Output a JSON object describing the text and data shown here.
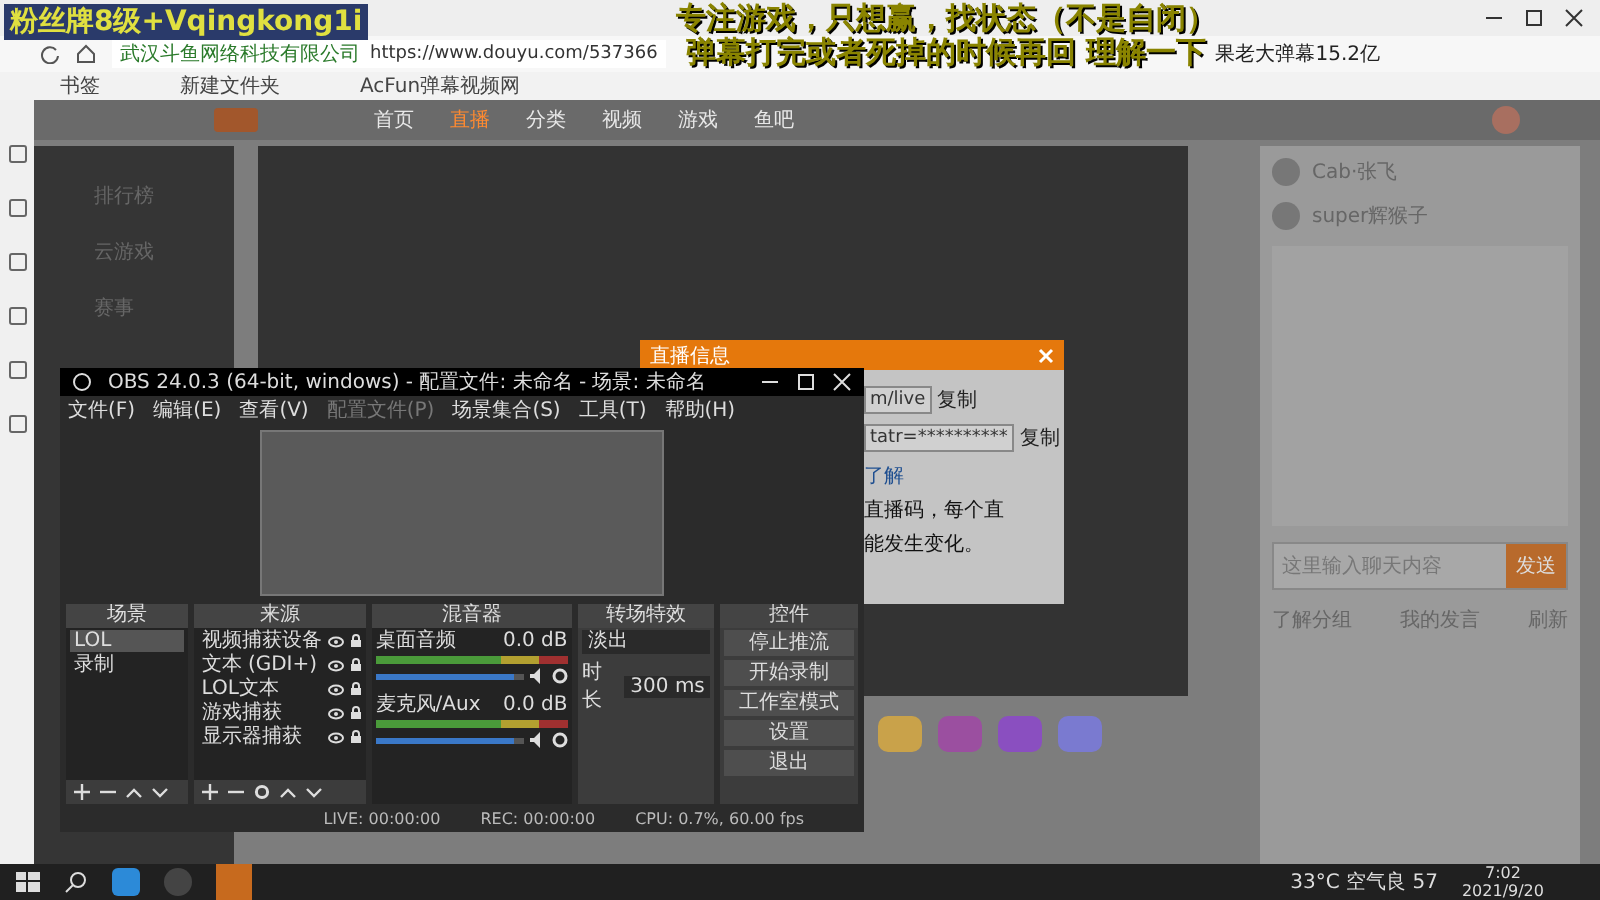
{
  "captions": {
    "badge": "粉丝牌8级+Vqingkong1i",
    "lines": [
      "专注游戏，只想赢，找状态（不是自闭）",
      "弹幕打完或者死掉的时候再回 理解一下"
    ]
  },
  "browser": {
    "site_name": "武汉斗鱼网络科技有限公司",
    "url": "https://www.douyu.com/537366",
    "tab_title": "果老大弹幕15.2亿",
    "bookmarks": [
      "书签",
      "新建文件夹",
      "AcFun弹幕视频网"
    ]
  },
  "site_nav": [
    {
      "label": "首页",
      "selected": false
    },
    {
      "label": "直播",
      "selected": true
    },
    {
      "label": "分类",
      "selected": false
    },
    {
      "label": "视频",
      "selected": false
    },
    {
      "label": "游戏",
      "selected": false
    },
    {
      "label": "鱼吧",
      "selected": false
    }
  ],
  "side_menu": [
    "排行榜",
    "云游戏",
    "赛事"
  ],
  "dialog": {
    "title": "直播信息",
    "fields": [
      {
        "value": "m/live",
        "button": "复制"
      },
      {
        "value": "tatr=**********",
        "button": "复制"
      }
    ],
    "link": "了解",
    "notes": [
      "直播码，每个直",
      "能发生变化。"
    ]
  },
  "obs": {
    "title": "OBS 24.0.3 (64-bit, windows) - 配置文件: 未命名 - 场景: 未命名",
    "menu": [
      {
        "label": "文件(F)",
        "disabled": false
      },
      {
        "label": "编辑(E)",
        "disabled": false
      },
      {
        "label": "查看(V)",
        "disabled": false
      },
      {
        "label": "配置文件(P)",
        "disabled": true
      },
      {
        "label": "场景集合(S)",
        "disabled": false
      },
      {
        "label": "工具(T)",
        "disabled": false
      },
      {
        "label": "帮助(H)",
        "disabled": false
      }
    ],
    "scenes": {
      "title": "场景",
      "items": [
        {
          "label": "LOL",
          "selected": true
        },
        {
          "label": "录制",
          "selected": false
        }
      ]
    },
    "sources": {
      "title": "来源",
      "items": [
        "视频捕获设备",
        "文本 (GDI+)",
        "LOL文本",
        "游戏捕获",
        "显示器捕获"
      ]
    },
    "mixer": {
      "title": "混音器",
      "channels": [
        {
          "name": "桌面音频",
          "reading": "0.0 dB",
          "level": 0.93
        },
        {
          "name": "麦克风/Aux",
          "reading": "0.0 dB",
          "level": 0.93
        }
      ]
    },
    "transitions": {
      "title": "转场特效",
      "effect": "淡出",
      "duration_label": "时长",
      "duration": "300 ms"
    },
    "controls": {
      "title": "控件",
      "buttons": [
        "停止推流",
        "开始录制",
        "工作室模式",
        "设置",
        "退出"
      ]
    },
    "status": [
      "LIVE: 00:00:00",
      "REC: 00:00:00",
      "CPU: 0.7%, 60.00 fps"
    ]
  },
  "chat": {
    "users": [
      "Cab·张飞",
      "super辉猴子"
    ],
    "input": {
      "placeholder": "这里输入聊天内容",
      "send": "发送"
    },
    "footer": [
      "了解分组",
      "我的发言",
      "刷新"
    ]
  },
  "taskbar": {
    "weather": "33°C 空气良 57",
    "time": "7:02",
    "date": "2021/9/20"
  }
}
